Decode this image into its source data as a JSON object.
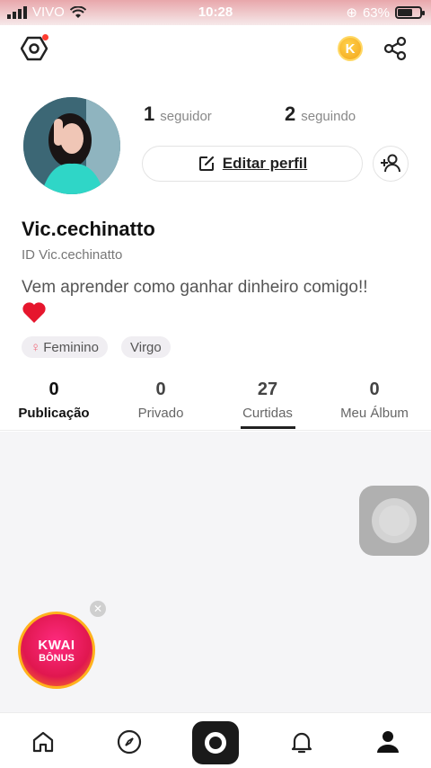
{
  "status_bar": {
    "carrier": "VIVO",
    "time": "10:28",
    "battery": "63%"
  },
  "header": {
    "settings_icon": "hexagon-settings-icon",
    "coin_icon": "k-coin-icon",
    "coin_letter": "K",
    "share_icon": "share-icon"
  },
  "profile": {
    "followers_count": "1",
    "followers_label": "seguidor",
    "following_count": "2",
    "following_label": "seguindo",
    "edit_label": "Editar perfil",
    "username": "Vic.cechinatto",
    "user_id": "ID Vic.cechinatto",
    "bio": "Vem aprender como ganhar dinheiro comigo!!",
    "tags": [
      {
        "icon": "female-symbol-icon",
        "label": "Feminino"
      },
      {
        "label": "Virgo"
      }
    ]
  },
  "tabs": [
    {
      "count": "0",
      "label": "Publicação"
    },
    {
      "count": "0",
      "label": "Privado"
    },
    {
      "count": "27",
      "label": "Curtidas"
    },
    {
      "count": "0",
      "label": "Meu Álbum"
    }
  ],
  "bonus": {
    "line1": "KWAI",
    "line2": "BÔNUS"
  },
  "bottom_nav": [
    "home-icon",
    "compass-icon",
    "camera-icon",
    "bell-icon",
    "profile-icon"
  ],
  "colors": {
    "accent": "#fe3b2f",
    "coin": "#f3a41a",
    "bonus": "#e0174f"
  }
}
